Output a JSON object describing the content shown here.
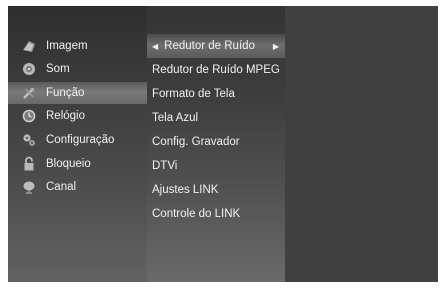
{
  "menu": {
    "items": [
      {
        "label": "Imagem",
        "icon": "picture-icon"
      },
      {
        "label": "Som",
        "icon": "sound-icon"
      },
      {
        "label": "Função",
        "icon": "function-icon"
      },
      {
        "label": "Relógio",
        "icon": "clock-icon"
      },
      {
        "label": "Configuração",
        "icon": "setup-icon"
      },
      {
        "label": "Bloqueio",
        "icon": "lock-icon"
      },
      {
        "label": "Canal",
        "icon": "channel-icon"
      }
    ],
    "selected": "Função"
  },
  "submenu": {
    "items": [
      {
        "label": "Redutor de Ruído"
      },
      {
        "label": "Redutor de Ruído MPEG"
      },
      {
        "label": "Formato de Tela"
      },
      {
        "label": "Tela Azul"
      },
      {
        "label": "Config. Gravador"
      },
      {
        "label": "DTVi"
      },
      {
        "label": "Ajustes LINK"
      },
      {
        "label": "Controle do LINK"
      }
    ],
    "selected": "Redutor de Ruído",
    "left_arrow": "◀",
    "right_arrow": "▶"
  }
}
